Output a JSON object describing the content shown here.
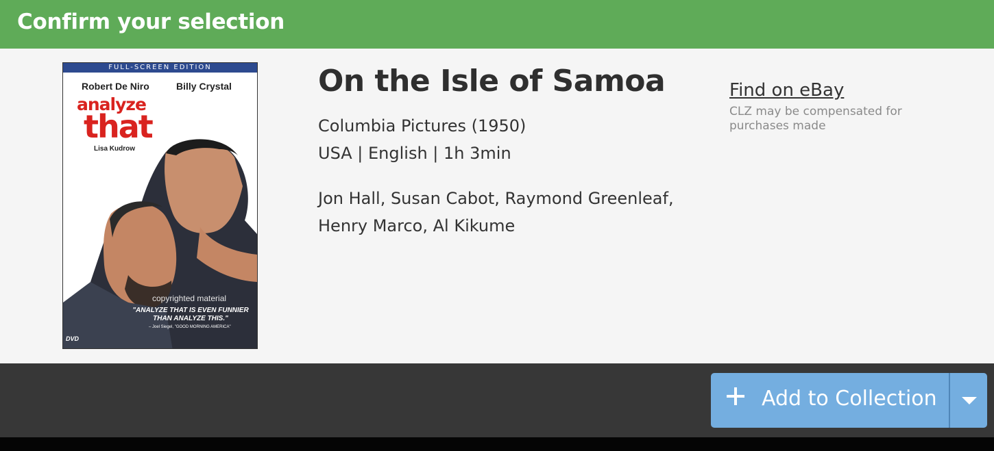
{
  "header": {
    "title": "Confirm your selection"
  },
  "cover": {
    "band_text": "FULL-SCREEN EDITION",
    "actor_1": "Robert De Niro",
    "actor_2": "Billy Crystal",
    "title_line_1": "analyze",
    "title_line_2": "that",
    "supporting": "Lisa Kudrow",
    "copyright": "copyrighted material",
    "quote": "\"ANALYZE THAT IS EVEN FUNNIER THAN ANALYZE THIS.\"",
    "quote_source": "– Joel Siegel, \"GOOD MORNING AMERICA\"",
    "format_logo": "DVD"
  },
  "movie": {
    "title": "On the Isle of Samoa",
    "studio_year": "Columbia Pictures (1950)",
    "details": "USA | English | 1h 3min",
    "cast": "Jon Hall, Susan Cabot, Raymond Greenleaf, Henry Marco, Al Kikume"
  },
  "ebay": {
    "link_label": "Find on eBay",
    "note": "CLZ may be compensated for purchases made"
  },
  "footer": {
    "add_label": "Add to Collection",
    "add_icon": "plus-icon",
    "dropdown_icon": "caret-down-icon"
  },
  "colors": {
    "header_bg": "#5fab58",
    "content_bg": "#f5f5f5",
    "footer_bg": "#373737",
    "button_bg": "#74aee0"
  }
}
